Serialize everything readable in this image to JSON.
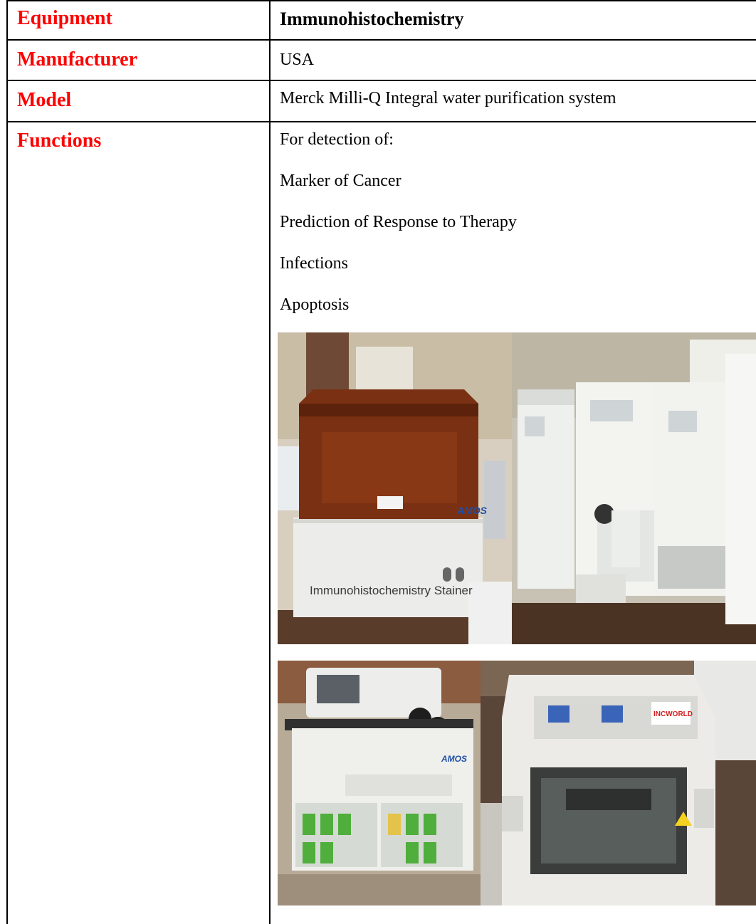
{
  "rows": {
    "equipment": {
      "label": "Equipment",
      "value": "Immunohistochemistry"
    },
    "manufacturer": {
      "label": "Manufacturer",
      "value": "USA"
    },
    "model": {
      "label": "Model",
      "value": "Merck Milli-Q Integral water purification system"
    },
    "functions": {
      "label": "Functions",
      "lines": [
        "For detection of:",
        "Marker of Cancer",
        "Prediction of Response to Therapy",
        "Infections",
        "Apoptosis"
      ]
    }
  },
  "photos": {
    "stainer_caption": "Immunohistochemistry Stainer",
    "stainer_brand": "AMOS",
    "processor_brand": "AMOS",
    "embedding_brand": "INCWORLD"
  },
  "colors": {
    "label_red": "#ff0000",
    "border": "#000000"
  }
}
